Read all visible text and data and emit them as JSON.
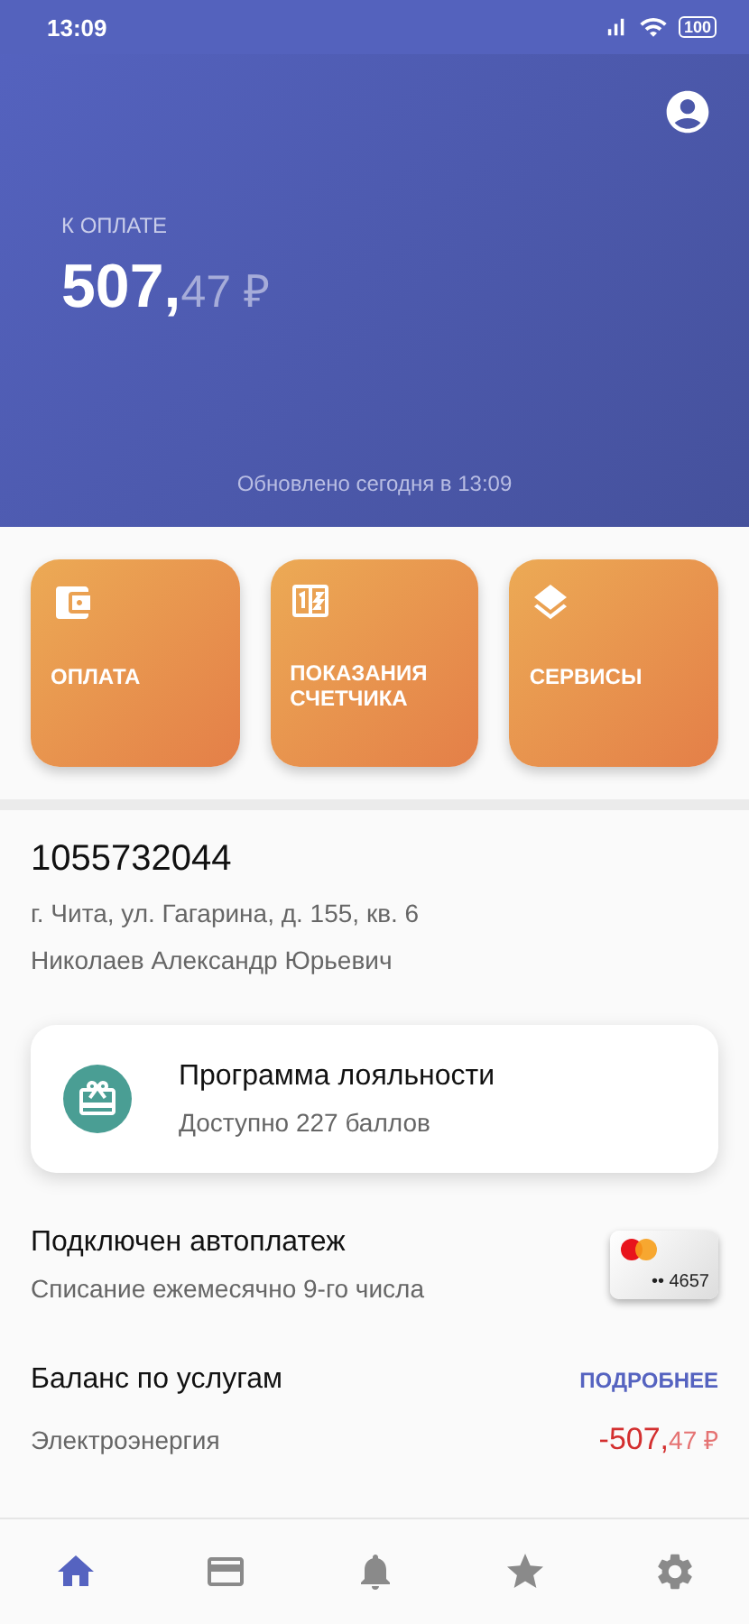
{
  "status_bar": {
    "time": "13:09",
    "battery": "100"
  },
  "header": {
    "label": "К ОПЛАТЕ",
    "amount_whole": "507,",
    "amount_fraction": "47 ₽",
    "updated": "Обновлено сегодня в 13:09"
  },
  "tiles": [
    {
      "label": "ОПЛАТА"
    },
    {
      "label": "ПОКАЗАНИЯ СЧЕТЧИКА"
    },
    {
      "label": "СЕРВИСЫ"
    }
  ],
  "account": {
    "number": "1055732044",
    "address": "г. Чита, ул. Гагарина, д. 155, кв. 6",
    "owner": "Николаев Александр Юрьевич"
  },
  "loyalty": {
    "title": "Программа лояльности",
    "subtitle": "Доступно 227 баллов"
  },
  "autopay": {
    "title": "Подключен автоплатеж",
    "subtitle": "Списание ежемесячно 9-го числа",
    "card_number": "•• 4657"
  },
  "balance": {
    "title": "Баланс по услугам",
    "link": "ПОДРОБНЕЕ",
    "rows": [
      {
        "name": "Электроэнергия",
        "amount_whole": "-507,",
        "amount_fraction": "47 ₽"
      }
    ]
  },
  "nav": [
    {
      "selected": true
    },
    {
      "selected": false
    },
    {
      "selected": false
    },
    {
      "selected": false
    },
    {
      "selected": false
    }
  ]
}
